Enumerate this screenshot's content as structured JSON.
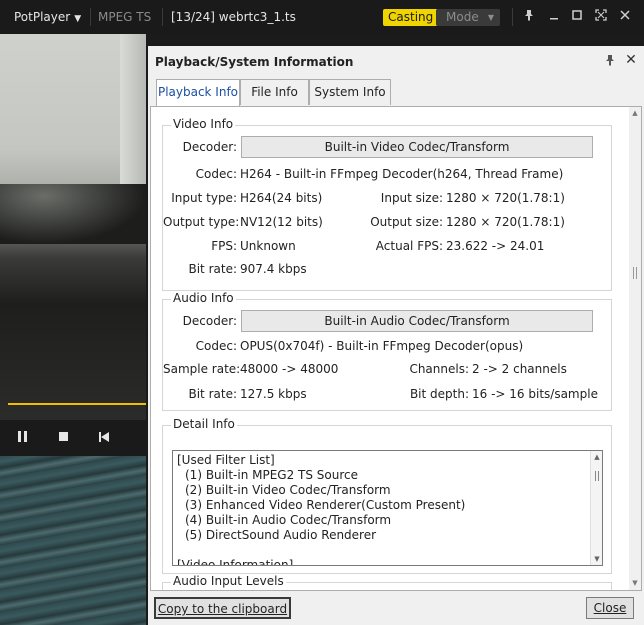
{
  "player": {
    "app_name": "PotPlayer",
    "format": "MPEG TS",
    "file_title": "[13/24]  webrtc3_1.ts",
    "casting_label": "Casting",
    "mode_label": "Mode",
    "icons": [
      "pin-icon",
      "minimize-icon",
      "maximize-icon",
      "fullscreen-icon",
      "close-icon"
    ],
    "seek_color": "#f0c000",
    "casting_color": "#f0d400"
  },
  "dialog": {
    "title": "Playback/System Information",
    "tabs": [
      {
        "label": "Playback Info",
        "active": true
      },
      {
        "label": "File Info",
        "active": false
      },
      {
        "label": "System Info",
        "active": false
      }
    ],
    "video_info": {
      "group_label": "Video Info",
      "decoder_label": "Decoder:",
      "decoder_value": "Built-in Video Codec/Transform",
      "codec_label": "Codec:",
      "codec_value": "H264 - Built-in FFmpeg Decoder(h264, Thread Frame)",
      "input_type_label": "Input type:",
      "input_type_value": "H264(24 bits)",
      "input_size_label": "Input size:",
      "input_size_value": "1280 × 720(1.78:1)",
      "output_type_label": "Output type:",
      "output_type_value": "NV12(12 bits)",
      "output_size_label": "Output size:",
      "output_size_value": "1280 × 720(1.78:1)",
      "fps_label": "FPS:",
      "fps_value": "Unknown",
      "actual_fps_label": "Actual FPS:",
      "actual_fps_value": "23.622 -> 24.01",
      "bit_rate_label": "Bit rate:",
      "bit_rate_value": "907.4 kbps"
    },
    "audio_info": {
      "group_label": "Audio Info",
      "decoder_label": "Decoder:",
      "decoder_value": "Built-in Audio Codec/Transform",
      "codec_label": "Codec:",
      "codec_value": "OPUS(0x704f) - Built-in FFmpeg Decoder(opus)",
      "sample_rate_label": "Sample rate:",
      "sample_rate_value": "48000 -> 48000",
      "channels_label": "Channels:",
      "channels_value": "2 -> 2 channels",
      "bit_rate_label": "Bit rate:",
      "bit_rate_value": "127.5 kbps",
      "bit_depth_label": "Bit depth:",
      "bit_depth_value": "16 -> 16 bits/sample"
    },
    "detail_info": {
      "group_label": "Detail Info",
      "lines": [
        "[Used Filter List]",
        "  (1) Built-in MPEG2 TS Source",
        "  (2) Built-in Video Codec/Transform",
        "  (3) Enhanced Video Renderer(Custom Present)",
        "  (4) Built-in Audio Codec/Transform",
        "  (5) DirectSound Audio Renderer",
        "",
        "[Video Information]"
      ]
    },
    "audio_input_levels": {
      "group_label": "Audio Input Levels"
    },
    "copy_button": "Copy to the clipboard",
    "close_button": "Close"
  }
}
